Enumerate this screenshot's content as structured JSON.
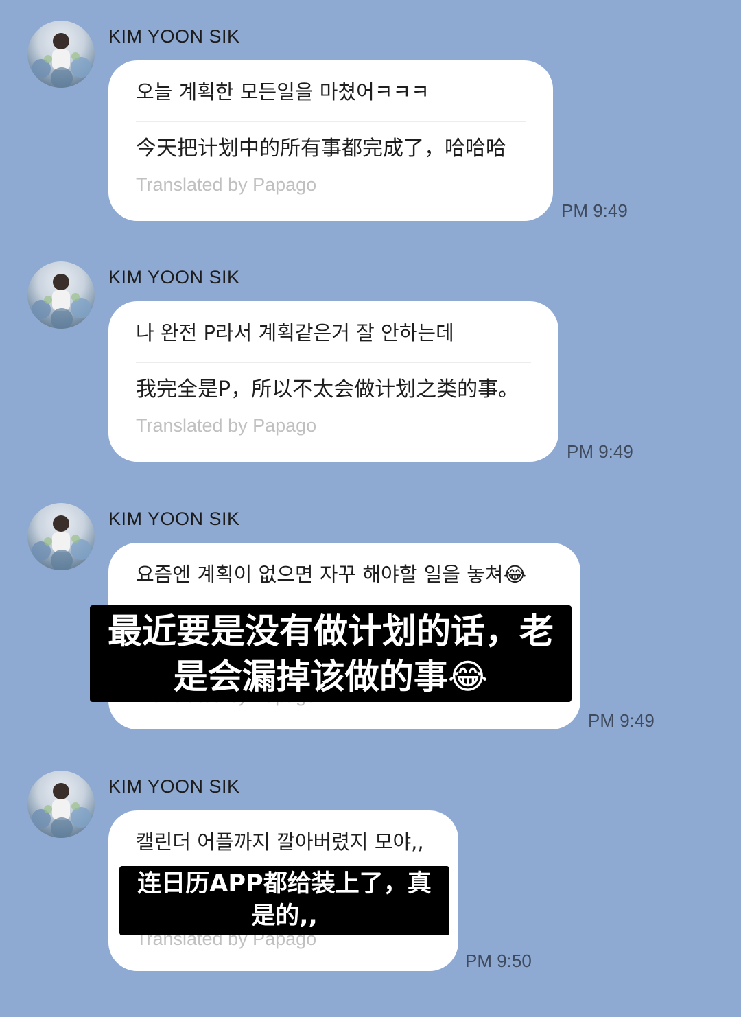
{
  "messages": [
    {
      "sender": "KIM YOON SIK",
      "original": "오늘 계획한 모든일을 마쳤어ㅋㅋㅋ",
      "translation": "今天把计划中的所有事都完成了，哈哈哈",
      "credit": "Translated by Papago",
      "time": "PM 9:49"
    },
    {
      "sender": "KIM YOON SIK",
      "original": "나 완전 P라서 계획같은거 잘 안하는데",
      "translation": "我完全是P，所以不太会做计划之类的事。",
      "credit": "Translated by Papago",
      "time": "PM 9:49"
    },
    {
      "sender": "KIM YOON SIK",
      "original": "요즘엔 계획이 없으면 자꾸 해야할 일을 놓쳐😂",
      "credit": "Translated by Papago",
      "time": "PM 9:49",
      "caption_line1": "最近要是没有做计划的话，老",
      "caption_line2": "是会漏掉该做的事😂"
    },
    {
      "sender": "KIM YOON SIK",
      "original": "캘린더 어플까지 깔아버렸지 모야,,",
      "credit": "Translated by Papago",
      "time": "PM 9:50",
      "caption_line1": "连日历APP都给装上了，真",
      "caption_line2": "是的,,"
    }
  ],
  "icons": {
    "avatar": "profile-photo-icon"
  }
}
